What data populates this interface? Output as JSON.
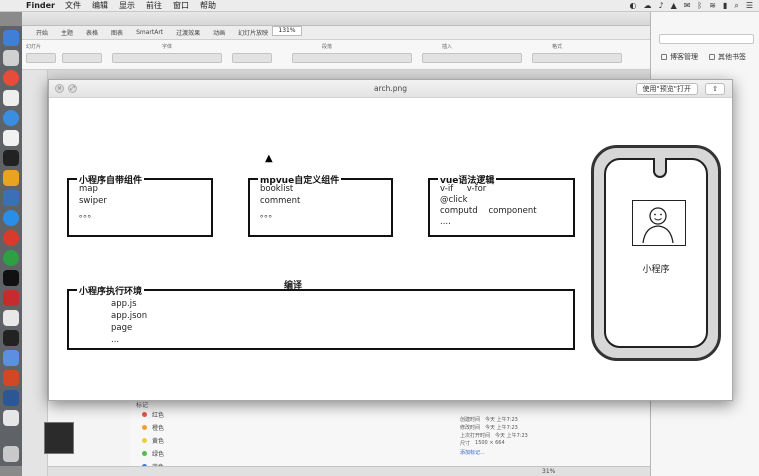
{
  "menubar": {
    "app": "Finder",
    "items": [
      "文件",
      "编辑",
      "显示",
      "前往",
      "窗口",
      "帮助"
    ],
    "status_icons": [
      "◐",
      "☁",
      "♪",
      "▲",
      "✉",
      "ᛒ",
      "≋",
      "▮",
      "⌕",
      "☰"
    ]
  },
  "keynote": {
    "tabs": [
      "开始",
      "主题",
      "表格",
      "图表",
      "SmartArt",
      "过渡效果",
      "动画",
      "幻灯片放映",
      "审阅"
    ],
    "ribbon_groups": [
      "幻灯片",
      "字体",
      "段落",
      "插入",
      "格式"
    ],
    "sidebar_labels": [
      "新建幻灯片",
      "布局"
    ],
    "zoom": "131%",
    "tags_header": "标记",
    "tags": [
      {
        "label": "红色",
        "color": "#e5534b"
      },
      {
        "label": "橙色",
        "color": "#f0a033"
      },
      {
        "label": "黄色",
        "color": "#e8cf3c"
      },
      {
        "label": "绿色",
        "color": "#58b94c"
      },
      {
        "label": "蓝色",
        "color": "#4178d8"
      }
    ],
    "file_info": [
      {
        "key": "创建时间",
        "value": "今天 上午7:23"
      },
      {
        "key": "修改时间",
        "value": "今天 上午7:23"
      },
      {
        "key": "上次打开时间",
        "value": "今天 上午7:23"
      },
      {
        "key": "尺寸",
        "value": "1500 × 664"
      }
    ],
    "add_tag_link": "添加标记...",
    "status_zoom": "31%"
  },
  "browser": {
    "search_placeholder": "",
    "bookmarks": [
      "博客管理",
      "其他书签"
    ]
  },
  "quicklook": {
    "title": "arch.png",
    "open_button": "使用\"预览\"打开",
    "share_icon": "share-icon",
    "diagram": {
      "box1": {
        "title": "小程序自带组件",
        "lines": [
          "map",
          "swiper",
          "。。。"
        ]
      },
      "box2": {
        "title": "mpvue自定义组件",
        "lines": [
          "booklist",
          "comment",
          "。。。"
        ]
      },
      "box3": {
        "title": "vue语法逻辑",
        "lines": [
          "v-if     v-for",
          "@click",
          "computd    component",
          "...."
        ]
      },
      "compile_label": "编译",
      "box4": {
        "title": "小程序执行环境",
        "lines": [
          "app.js",
          "app.json",
          "page",
          "..."
        ]
      },
      "phone_label": "小程序"
    }
  }
}
